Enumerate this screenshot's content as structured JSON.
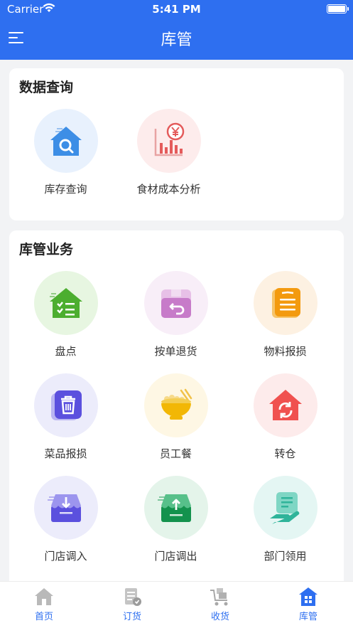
{
  "status_bar": {
    "carrier": "Carrier",
    "time": "5:41 PM"
  },
  "nav": {
    "title": "库管"
  },
  "query_section": {
    "title": "数据查询",
    "items": [
      {
        "label": "库存查询",
        "icon": "house-search-icon",
        "bg": "#e8f1fd"
      },
      {
        "label": "食材成本分析",
        "icon": "cost-chart-icon",
        "bg": "#fdecec"
      }
    ]
  },
  "ops_section": {
    "title": "库管业务",
    "items": [
      {
        "label": "盘点",
        "icon": "checklist-house-icon",
        "bg": "#e7f6e1"
      },
      {
        "label": "按单退货",
        "icon": "return-box-icon",
        "bg": "#f8eef8"
      },
      {
        "label": "物料报损",
        "icon": "material-report-icon",
        "bg": "#fdf1e2"
      },
      {
        "label": "菜品报损",
        "icon": "trash-icon",
        "bg": "#ececfb"
      },
      {
        "label": "员工餐",
        "icon": "meal-bowl-icon",
        "bg": "#fef7e4"
      },
      {
        "label": "转仓",
        "icon": "transfer-house-icon",
        "bg": "#fdebeb"
      },
      {
        "label": "门店调入",
        "icon": "store-in-icon",
        "bg": "#ececfb"
      },
      {
        "label": "门店调出",
        "icon": "store-out-icon",
        "bg": "#e4f4ea"
      },
      {
        "label": "部门领用",
        "icon": "dept-collect-icon",
        "bg": "#e4f6f3"
      }
    ]
  },
  "tabbar": {
    "items": [
      {
        "label": "首页",
        "icon": "home-icon"
      },
      {
        "label": "订货",
        "icon": "order-icon"
      },
      {
        "label": "收货",
        "icon": "receive-cart-icon"
      },
      {
        "label": "库管",
        "icon": "warehouse-icon"
      }
    ],
    "active_index": 3,
    "active_color": "#2e6ff0"
  },
  "colors": {
    "primary": "#2e6ff0"
  }
}
